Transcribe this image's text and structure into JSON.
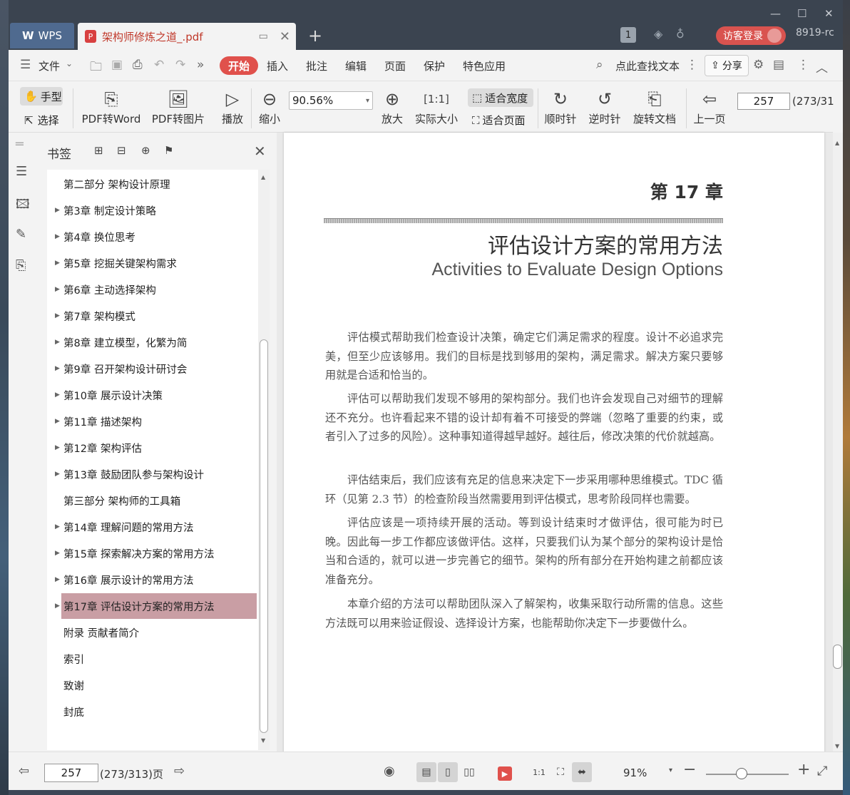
{
  "titlebar": {
    "wps_tab": "WPS",
    "doc_tab": "架构师修炼之道_.pdf",
    "badge": "1",
    "login": "访客登录",
    "version": "8919-rc"
  },
  "menubar": {
    "file": "文件",
    "items": [
      "开始",
      "插入",
      "批注",
      "编辑",
      "页面",
      "保护",
      "特色应用"
    ],
    "search": "点此查找文本",
    "share": "分享"
  },
  "toolbar": {
    "hand": "手型",
    "select": "选择",
    "pdf_to_word": "PDF转Word",
    "pdf_to_image": "PDF转图片",
    "play": "播放",
    "zoom_out": "缩小",
    "zoom_value": "90.56%",
    "zoom_in": "放大",
    "actual_size": "实际大小",
    "fit_width": "适合宽度",
    "fit_page": "适合页面",
    "rotate_cw": "顺时针",
    "rotate_ccw": "逆时针",
    "rotate_doc": "旋转文档",
    "prev_page": "上一页",
    "page_number": "257",
    "page_total": "(273/31"
  },
  "bookmarks": {
    "title": "书签",
    "items": [
      {
        "label": "第二部分  架构设计原理",
        "expandable": false,
        "active": false
      },
      {
        "label": "第3章  制定设计策略",
        "expandable": true,
        "active": false
      },
      {
        "label": "第4章  换位思考",
        "expandable": true,
        "active": false
      },
      {
        "label": "第5章  挖掘关键架构需求",
        "expandable": true,
        "active": false
      },
      {
        "label": "第6章  主动选择架构",
        "expandable": true,
        "active": false
      },
      {
        "label": "第7章  架构模式",
        "expandable": true,
        "active": false
      },
      {
        "label": "第8章  建立模型，化繁为简",
        "expandable": true,
        "active": false
      },
      {
        "label": "第9章  召开架构设计研讨会",
        "expandable": true,
        "active": false
      },
      {
        "label": "第10章  展示设计决策",
        "expandable": true,
        "active": false
      },
      {
        "label": "第11章  描述架构",
        "expandable": true,
        "active": false
      },
      {
        "label": "第12章  架构评估",
        "expandable": true,
        "active": false
      },
      {
        "label": "第13章  鼓励团队参与架构设计",
        "expandable": true,
        "active": false
      },
      {
        "label": "第三部分  架构师的工具箱",
        "expandable": false,
        "active": false
      },
      {
        "label": "第14章  理解问题的常用方法",
        "expandable": true,
        "active": false
      },
      {
        "label": "第15章  探索解决方案的常用方法",
        "expandable": true,
        "active": false
      },
      {
        "label": "第16章  展示设计的常用方法",
        "expandable": true,
        "active": false
      },
      {
        "label": "第17章  评估设计方案的常用方法",
        "expandable": true,
        "active": true
      },
      {
        "label": "附录  贡献者简介",
        "expandable": false,
        "active": false
      },
      {
        "label": "索引",
        "expandable": false,
        "active": false
      },
      {
        "label": "致谢",
        "expandable": false,
        "active": false
      },
      {
        "label": "封底",
        "expandable": false,
        "active": false
      }
    ]
  },
  "page": {
    "chapter": "第 17 章",
    "title": "评估设计方案的常用方法",
    "subtitle": "Activities to Evaluate Design Options",
    "paragraphs": [
      "评估模式帮助我们检查设计决策，确定它们满足需求的程度。设计不必追求完美，但至少应该够用。我们的目标是找到够用的架构，满足需求。解决方案只要够用就是合适和恰当的。",
      "评估可以帮助我们发现不够用的架构部分。我们也许会发现自己对细节的理解还不充分。也许看起来不错的设计却有着不可接受的弊端（忽略了重要的约束，或者引入了过多的风险）。这种事知道得越早越好。越往后，修改决策的代价就越高。",
      "评估结束后，我们应该有充足的信息来决定下一步采用哪种思维模式。TDC 循环（见第 2.3 节）的检查阶段当然需要用到评估模式，思考阶段同样也需要。",
      "评估应该是一项持续开展的活动。等到设计结束时才做评估，很可能为时已晚。因此每一步工作都应该做评估。这样，只要我们认为某个部分的架构设计是恰当和合适的，就可以进一步完善它的细节。架构的所有部分在开始构建之前都应该准备充分。",
      "本章介绍的方法可以帮助团队深入了解架构，收集采取行动所需的信息。这些方法既可以用来验证假设、选择设计方案，也能帮助你决定下一步要做什么。"
    ]
  },
  "statusbar": {
    "page_number": "257",
    "page_total": "(273/313)页",
    "zoom": "91%"
  },
  "colors": {
    "accent": "#e0514c",
    "titlebar": "#3b4450",
    "bookmark_active": "#c99ea4"
  }
}
